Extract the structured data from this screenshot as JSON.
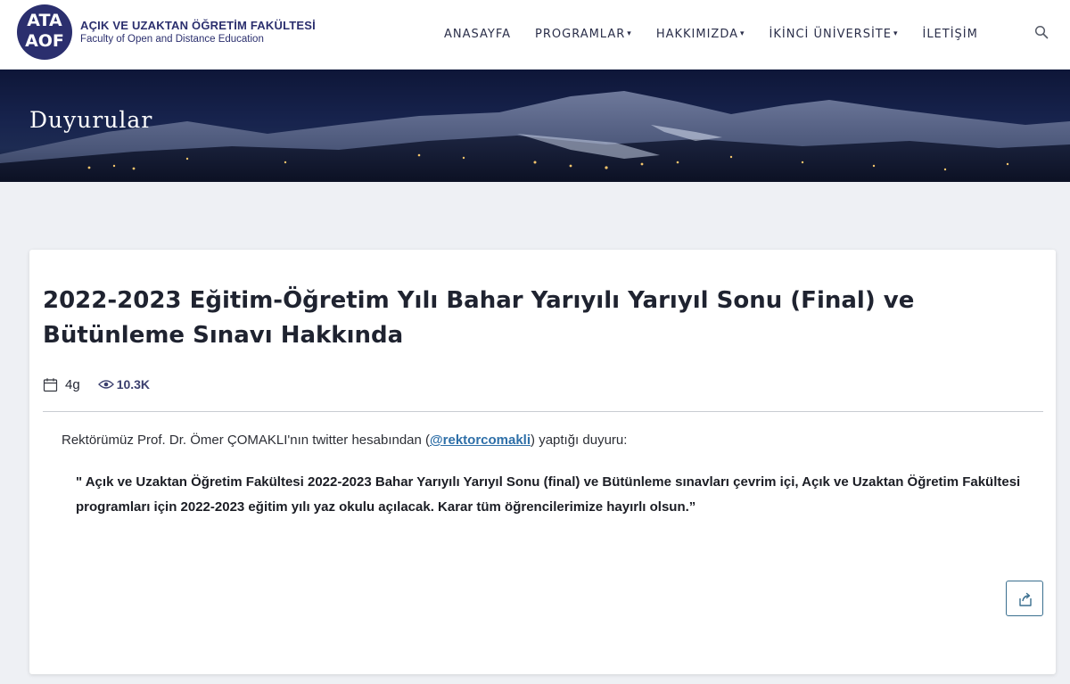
{
  "header": {
    "logo_line1": "ATA",
    "logo_line2": "AOF",
    "title": "AÇIK VE UZAKTAN ÖĞRETİM FAKÜLTESİ",
    "subtitle": "Faculty of Open and Distance Education",
    "nav": [
      {
        "label": "ANASAYFA",
        "caret": ""
      },
      {
        "label": "PROGRAMLAR",
        "caret": "▾"
      },
      {
        "label": "HAKKIMIZDA",
        "caret": "▾"
      },
      {
        "label": "İKİNCİ ÜNİVERSİTE",
        "caret": "▾"
      },
      {
        "label": "İLETİŞİM",
        "caret": ""
      }
    ],
    "search_icon": "search-icon"
  },
  "banner": {
    "title": "Duyurular"
  },
  "post": {
    "title": "2022-2023 Eğitim-Öğretim Yılı Bahar Yarıyılı Yarıyıl Sonu (Final) ve Bütünleme Sınavı Hakkında",
    "date": "4g",
    "views": "10.3K",
    "intro_before": "Rektörümüz Prof. Dr. Ömer ÇOMAKLI'nın twitter hesabından (",
    "intro_link": "@rektorcomakli",
    "intro_after": ") yaptığı duyuru:",
    "quote": "\" Açık ve Uzaktan Öğretim Fakültesi 2022-2023 Bahar Yarıyılı Yarıyıl Sonu (final) ve Bütünleme sınavları çevrim içi, Açık ve Uzaktan Öğretim Fakültesi programları için 2022-2023 eğitim yılı yaz okulu açılacak. Karar tüm öğrencilerimize hayırlı olsun.”"
  },
  "colors": {
    "brand": "#2b2f6e",
    "link": "#2e6fa8",
    "share_border": "#3a6f8f"
  }
}
